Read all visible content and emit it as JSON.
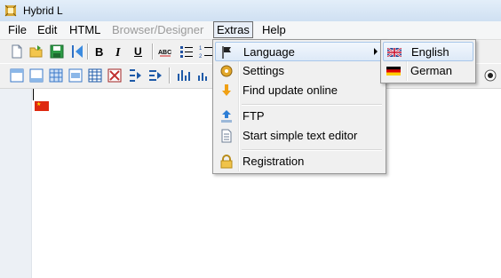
{
  "window": {
    "title": "Hybrid L"
  },
  "menubar": {
    "items": [
      {
        "label": "File",
        "state": "normal"
      },
      {
        "label": "Edit",
        "state": "normal"
      },
      {
        "label": "HTML",
        "state": "normal"
      },
      {
        "label": "Browser/Designer",
        "state": "disabled"
      },
      {
        "label": "Extras",
        "state": "active"
      },
      {
        "label": "Help",
        "state": "normal"
      }
    ]
  },
  "toolbar1": {
    "buttons": [
      "new-document-icon",
      "open-folder-icon",
      "save-icon",
      "navigate-icon",
      "bold-icon",
      "italic-icon",
      "underline-icon",
      "spellcheck-icon",
      "bulleted-list-icon",
      "numbered-list-icon"
    ]
  },
  "toolbar2": {
    "buttons": [
      "layout-top-icon",
      "layout-bottom-icon",
      "table-grid-icon",
      "frame-icon",
      "table-icon",
      "image-icon",
      "indent-icon",
      "outdent-icon",
      "format-icon",
      "chart-icon"
    ]
  },
  "extras_menu": {
    "items": [
      {
        "label": "Language",
        "icon": "flag-icon",
        "has_submenu": true,
        "highlighted": true
      },
      {
        "label": "Settings",
        "icon": "settings-icon"
      },
      {
        "label": "Find update online",
        "icon": "download-icon"
      },
      {
        "separator": true
      },
      {
        "label": "FTP",
        "icon": "upload-icon"
      },
      {
        "label": "Start simple text editor",
        "icon": "text-editor-icon"
      },
      {
        "separator": true
      },
      {
        "label": "Registration",
        "icon": "lock-icon"
      }
    ]
  },
  "language_submenu": {
    "items": [
      {
        "label": "English",
        "flag": "uk-flag-icon",
        "highlighted": true
      },
      {
        "label": "German",
        "flag": "germany-flag-icon"
      }
    ]
  },
  "editor": {
    "content": ""
  }
}
